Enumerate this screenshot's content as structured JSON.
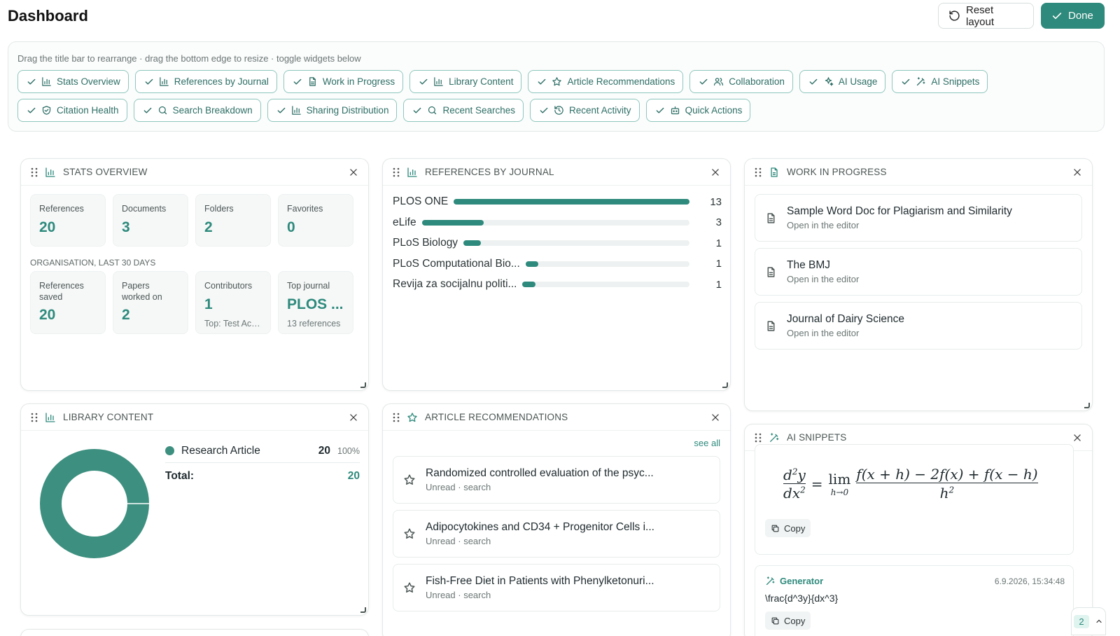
{
  "header": {
    "title": "Dashboard",
    "reset_label": "Reset layout",
    "done_label": "Done"
  },
  "toggles": {
    "hint": "Drag the title bar to rearrange · drag the bottom edge to resize · toggle widgets below",
    "chips": [
      {
        "label": "Stats Overview",
        "icon": "bar-chart-icon"
      },
      {
        "label": "References by Journal",
        "icon": "bar-chart-icon"
      },
      {
        "label": "Work in Progress",
        "icon": "document-icon"
      },
      {
        "label": "Library Content",
        "icon": "bar-chart-icon"
      },
      {
        "label": "Article Recommendations",
        "icon": "star-icon"
      },
      {
        "label": "Collaboration",
        "icon": "users-icon"
      },
      {
        "label": "AI Usage",
        "icon": "sparkles-icon"
      },
      {
        "label": "AI Snippets",
        "icon": "magic-wand-icon"
      },
      {
        "label": "Citation Health",
        "icon": "shield-check-icon"
      },
      {
        "label": "Search Breakdown",
        "icon": "search-icon"
      },
      {
        "label": "Sharing Distribution",
        "icon": "bar-chart-icon"
      },
      {
        "label": "Recent Searches",
        "icon": "search-icon"
      },
      {
        "label": "Recent Activity",
        "icon": "history-icon"
      },
      {
        "label": "Quick Actions",
        "icon": "bot-icon"
      }
    ]
  },
  "stats": {
    "title": "Stats Overview",
    "cards": [
      {
        "label": "References",
        "value": "20"
      },
      {
        "label": "Documents",
        "value": "3"
      },
      {
        "label": "Folders",
        "value": "2"
      },
      {
        "label": "Favorites",
        "value": "0"
      }
    ],
    "org_label": "ORGANISATION, LAST 30 DAYS",
    "org_cards": [
      {
        "label": "References saved",
        "value": "20",
        "sub": ""
      },
      {
        "label": "Papers worked on",
        "value": "2",
        "sub": ""
      },
      {
        "label": "Contributors",
        "value": "1",
        "sub": "Top: Test Acc..."
      },
      {
        "label": "Top journal",
        "value": "PLOS ...",
        "sub": "13 references"
      }
    ]
  },
  "journals": {
    "title": "References by Journal",
    "rows": [
      {
        "name": "PLOS ONE",
        "count": 13
      },
      {
        "name": "eLife",
        "count": 3
      },
      {
        "name": "PLoS Biology",
        "count": 1
      },
      {
        "name": "PLoS Computational Bio...",
        "count": 1
      },
      {
        "name": "Revija za socijalnu politi...",
        "count": 1
      }
    ]
  },
  "wip": {
    "title": "Work in Progress",
    "items": [
      {
        "title": "Sample Word Doc for Plagiarism and Similarity",
        "sub": "Open in the editor"
      },
      {
        "title": "The BMJ",
        "sub": "Open in the editor"
      },
      {
        "title": "Journal of Dairy Science",
        "sub": "Open in the editor"
      }
    ]
  },
  "library": {
    "title": "Library Content",
    "legend": [
      {
        "label": "Research Article",
        "count": "20",
        "pct": "100%"
      }
    ],
    "total_label": "Total:",
    "total_value": "20",
    "color": "#3d8f7f"
  },
  "recommendations": {
    "title": "Article Recommendations",
    "see_all": "see all",
    "items": [
      {
        "title": "Randomized controlled evaluation of the psyc...",
        "sub": "Unread · search"
      },
      {
        "title": "Adipocytokines and CD34 + Progenitor Cells i...",
        "sub": "Unread · search"
      },
      {
        "title": "Fish-Free Diet in Patients with Phenylketonuri...",
        "sub": "Unread · search"
      }
    ]
  },
  "snippets": {
    "title": "AI Snippets",
    "copy_label": "Copy",
    "generator_label": "Generator",
    "generator_time": "6.9.2026, 15:34:48",
    "generator_code": "\\frac{d^3y}{dx^3}"
  },
  "floating": {
    "count": "2"
  },
  "colors": {
    "accent": "#2e8a7c"
  }
}
